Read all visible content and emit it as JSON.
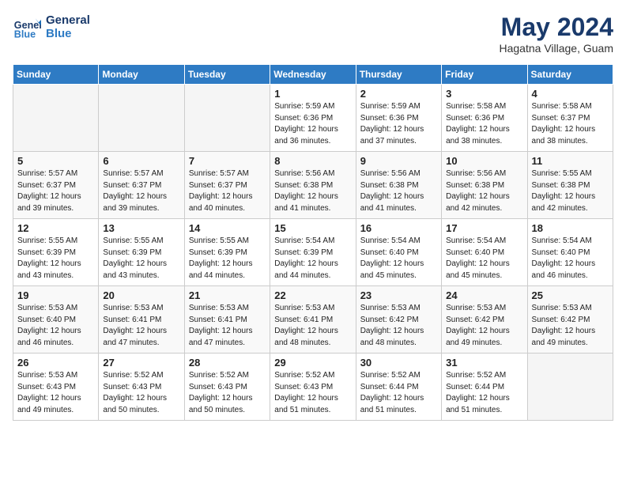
{
  "header": {
    "logo_line1": "General",
    "logo_line2": "Blue",
    "month_title": "May 2024",
    "subtitle": "Hagatna Village, Guam"
  },
  "weekdays": [
    "Sunday",
    "Monday",
    "Tuesday",
    "Wednesday",
    "Thursday",
    "Friday",
    "Saturday"
  ],
  "weeks": [
    [
      {
        "day": "",
        "sunrise": "",
        "sunset": "",
        "daylight": "",
        "empty": true
      },
      {
        "day": "",
        "sunrise": "",
        "sunset": "",
        "daylight": "",
        "empty": true
      },
      {
        "day": "",
        "sunrise": "",
        "sunset": "",
        "daylight": "",
        "empty": true
      },
      {
        "day": "1",
        "sunrise": "5:59 AM",
        "sunset": "6:36 PM",
        "daylight": "12 hours and 36 minutes.",
        "empty": false
      },
      {
        "day": "2",
        "sunrise": "5:59 AM",
        "sunset": "6:36 PM",
        "daylight": "12 hours and 37 minutes.",
        "empty": false
      },
      {
        "day": "3",
        "sunrise": "5:58 AM",
        "sunset": "6:36 PM",
        "daylight": "12 hours and 38 minutes.",
        "empty": false
      },
      {
        "day": "4",
        "sunrise": "5:58 AM",
        "sunset": "6:37 PM",
        "daylight": "12 hours and 38 minutes.",
        "empty": false
      }
    ],
    [
      {
        "day": "5",
        "sunrise": "5:57 AM",
        "sunset": "6:37 PM",
        "daylight": "12 hours and 39 minutes.",
        "empty": false
      },
      {
        "day": "6",
        "sunrise": "5:57 AM",
        "sunset": "6:37 PM",
        "daylight": "12 hours and 39 minutes.",
        "empty": false
      },
      {
        "day": "7",
        "sunrise": "5:57 AM",
        "sunset": "6:37 PM",
        "daylight": "12 hours and 40 minutes.",
        "empty": false
      },
      {
        "day": "8",
        "sunrise": "5:56 AM",
        "sunset": "6:38 PM",
        "daylight": "12 hours and 41 minutes.",
        "empty": false
      },
      {
        "day": "9",
        "sunrise": "5:56 AM",
        "sunset": "6:38 PM",
        "daylight": "12 hours and 41 minutes.",
        "empty": false
      },
      {
        "day": "10",
        "sunrise": "5:56 AM",
        "sunset": "6:38 PM",
        "daylight": "12 hours and 42 minutes.",
        "empty": false
      },
      {
        "day": "11",
        "sunrise": "5:55 AM",
        "sunset": "6:38 PM",
        "daylight": "12 hours and 42 minutes.",
        "empty": false
      }
    ],
    [
      {
        "day": "12",
        "sunrise": "5:55 AM",
        "sunset": "6:39 PM",
        "daylight": "12 hours and 43 minutes.",
        "empty": false
      },
      {
        "day": "13",
        "sunrise": "5:55 AM",
        "sunset": "6:39 PM",
        "daylight": "12 hours and 43 minutes.",
        "empty": false
      },
      {
        "day": "14",
        "sunrise": "5:55 AM",
        "sunset": "6:39 PM",
        "daylight": "12 hours and 44 minutes.",
        "empty": false
      },
      {
        "day": "15",
        "sunrise": "5:54 AM",
        "sunset": "6:39 PM",
        "daylight": "12 hours and 44 minutes.",
        "empty": false
      },
      {
        "day": "16",
        "sunrise": "5:54 AM",
        "sunset": "6:40 PM",
        "daylight": "12 hours and 45 minutes.",
        "empty": false
      },
      {
        "day": "17",
        "sunrise": "5:54 AM",
        "sunset": "6:40 PM",
        "daylight": "12 hours and 45 minutes.",
        "empty": false
      },
      {
        "day": "18",
        "sunrise": "5:54 AM",
        "sunset": "6:40 PM",
        "daylight": "12 hours and 46 minutes.",
        "empty": false
      }
    ],
    [
      {
        "day": "19",
        "sunrise": "5:53 AM",
        "sunset": "6:40 PM",
        "daylight": "12 hours and 46 minutes.",
        "empty": false
      },
      {
        "day": "20",
        "sunrise": "5:53 AM",
        "sunset": "6:41 PM",
        "daylight": "12 hours and 47 minutes.",
        "empty": false
      },
      {
        "day": "21",
        "sunrise": "5:53 AM",
        "sunset": "6:41 PM",
        "daylight": "12 hours and 47 minutes.",
        "empty": false
      },
      {
        "day": "22",
        "sunrise": "5:53 AM",
        "sunset": "6:41 PM",
        "daylight": "12 hours and 48 minutes.",
        "empty": false
      },
      {
        "day": "23",
        "sunrise": "5:53 AM",
        "sunset": "6:42 PM",
        "daylight": "12 hours and 48 minutes.",
        "empty": false
      },
      {
        "day": "24",
        "sunrise": "5:53 AM",
        "sunset": "6:42 PM",
        "daylight": "12 hours and 49 minutes.",
        "empty": false
      },
      {
        "day": "25",
        "sunrise": "5:53 AM",
        "sunset": "6:42 PM",
        "daylight": "12 hours and 49 minutes.",
        "empty": false
      }
    ],
    [
      {
        "day": "26",
        "sunrise": "5:53 AM",
        "sunset": "6:43 PM",
        "daylight": "12 hours and 49 minutes.",
        "empty": false
      },
      {
        "day": "27",
        "sunrise": "5:52 AM",
        "sunset": "6:43 PM",
        "daylight": "12 hours and 50 minutes.",
        "empty": false
      },
      {
        "day": "28",
        "sunrise": "5:52 AM",
        "sunset": "6:43 PM",
        "daylight": "12 hours and 50 minutes.",
        "empty": false
      },
      {
        "day": "29",
        "sunrise": "5:52 AM",
        "sunset": "6:43 PM",
        "daylight": "12 hours and 51 minutes.",
        "empty": false
      },
      {
        "day": "30",
        "sunrise": "5:52 AM",
        "sunset": "6:44 PM",
        "daylight": "12 hours and 51 minutes.",
        "empty": false
      },
      {
        "day": "31",
        "sunrise": "5:52 AM",
        "sunset": "6:44 PM",
        "daylight": "12 hours and 51 minutes.",
        "empty": false
      },
      {
        "day": "",
        "sunrise": "",
        "sunset": "",
        "daylight": "",
        "empty": true
      }
    ]
  ]
}
